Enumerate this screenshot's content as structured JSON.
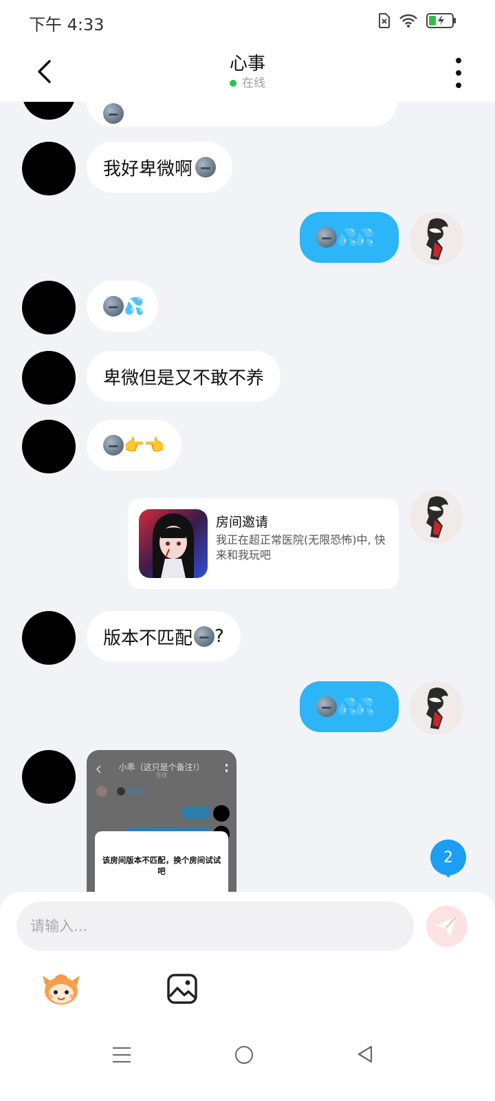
{
  "status_bar": {
    "time": "下午 4:33"
  },
  "header": {
    "title": "心事",
    "status": "在线"
  },
  "messages": {
    "m0": {
      "side": "left",
      "content": "🌚"
    },
    "m1": {
      "side": "left",
      "text": "我好卑微啊",
      "emoji": "🌚"
    },
    "m2": {
      "side": "right",
      "content": "🌚💦💦"
    },
    "m3": {
      "side": "left",
      "content": "🌚💦"
    },
    "m4": {
      "side": "left",
      "text": "卑微但是又不敢不养"
    },
    "m5": {
      "side": "left",
      "content": "🌚👉👈"
    },
    "m6": {
      "side": "right",
      "type": "room-invite",
      "title": "房间邀请",
      "description": "我正在超正常医院(无限恐怖)中, 快来和我玩吧"
    },
    "m7": {
      "side": "left",
      "text": "版本不匹配",
      "suffix": "?"
    },
    "m8": {
      "side": "right",
      "content": "🌚💦💦"
    },
    "m9": {
      "side": "left",
      "type": "screenshot",
      "screenshot_title": "小乖（这只是个备注!）",
      "screenshot_status": "在线",
      "dialog_text": "该房间版本不匹配，换个房间试试吧"
    }
  },
  "unread_badge": "2",
  "composer": {
    "placeholder": "请输入..."
  },
  "colors": {
    "accent_blue": "#2cb6f7",
    "badge_blue": "#1b9ef3",
    "online_green": "#24c44d"
  },
  "icons": [
    "back-arrow-icon",
    "more-vertical-icon",
    "send-icon",
    "mascot-icon",
    "image-icon",
    "menu-icon",
    "home-icon",
    "nav-back-icon"
  ]
}
